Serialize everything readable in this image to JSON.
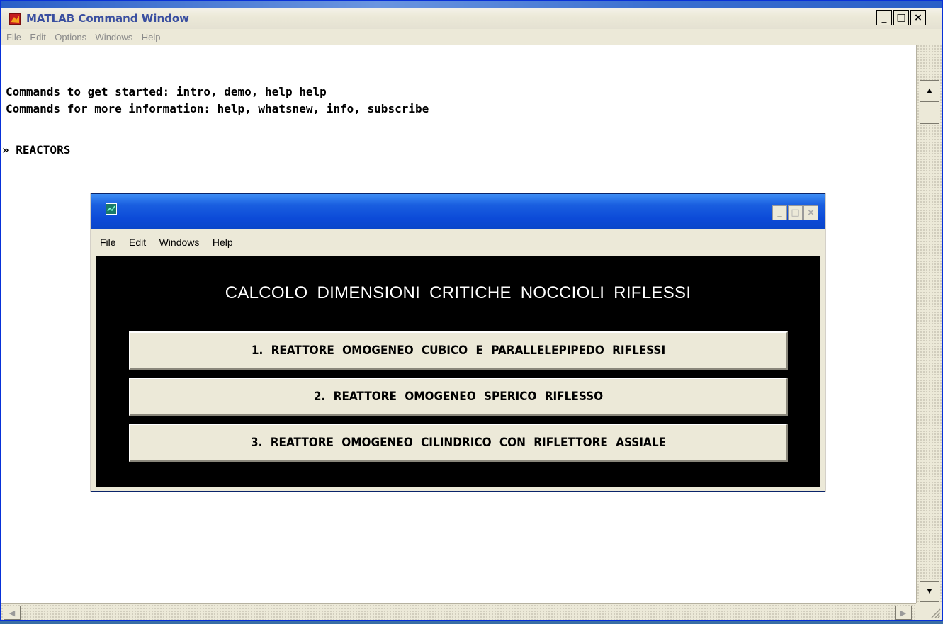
{
  "main_window": {
    "title": "MATLAB Command Window",
    "controls": {
      "minimize": "_",
      "maximize": "□",
      "close": "×"
    },
    "menu": [
      "File",
      "Edit",
      "Options",
      "Windows",
      "Help"
    ]
  },
  "console": {
    "lines": [
      "Commands to get started: intro, demo, help help",
      "Commands for more information: help, whatsnew, info, subscribe",
      "» REACTORS"
    ]
  },
  "figure_window": {
    "title": "",
    "controls": {
      "minimize": "_",
      "maximize": "□",
      "close": "×"
    },
    "menu": [
      "File",
      "Edit",
      "Windows",
      "Help"
    ],
    "heading": "CALCOLO  DIMENSIONI  CRITICHE  NOCCIOLI  RIFLESSI",
    "buttons": [
      "1.  REATTORE  OMOGENEO  CUBICO  E  PARALLELEPIPEDO  RIFLESSI",
      "2.  REATTORE  OMOGENEO  SPERICO   RIFLESSO",
      "3.  REATTORE  OMOGENEO  CILINDRICO  CON  RIFLETTORE  ASSIALE"
    ]
  },
  "icons": {
    "app": "matlab-logo-icon",
    "figure": "figure-icon",
    "scroll_up": "▲",
    "scroll_down": "▼",
    "scroll_left": "◀",
    "scroll_right": "▶"
  },
  "colors": {
    "figure_background": "#000000",
    "button_face": "#ece9d8",
    "title_active": "#0c4ad8"
  }
}
